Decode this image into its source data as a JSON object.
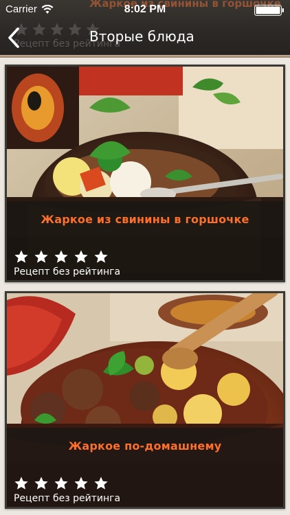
{
  "status_bar": {
    "carrier": "Carrier",
    "time": "8:02 PM"
  },
  "nav": {
    "title": "Вторые блюда",
    "back_icon": "chevron-left-icon"
  },
  "behind_header": {
    "title": "Жаркое из свинины в горшочке",
    "caption": "Рецепт без рейтинга"
  },
  "recipes": [
    {
      "title": "Жаркое из свинины в горшочке",
      "rating_text": "Рецепт без рейтинга",
      "stars": 5,
      "rating_value": 0
    },
    {
      "title": "Жаркое по-домашнему",
      "rating_text": "Рецепт без рейтинга",
      "stars": 5,
      "rating_value": 0
    }
  ],
  "colors": {
    "accent": "#ff6f2c",
    "bar": "#2b2825",
    "text": "#ffffff"
  }
}
